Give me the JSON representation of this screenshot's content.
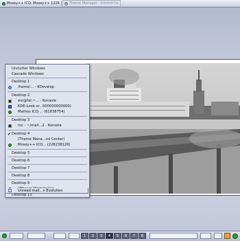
{
  "taskbar": {
    "tasks": [
      {
        "label": "Mosey++ ICQ: Mosey++ 1226",
        "active": true
      },
      {
        "label": "Theme Manager - Control Ce",
        "active": false
      }
    ]
  },
  "menu": {
    "items": [
      {
        "label": "Unclutter Windows",
        "kind": "action"
      },
      {
        "label": "Cascade Windows",
        "kind": "action"
      },
      {
        "label": "Desktop 1",
        "kind": "desktop"
      },
      {
        "label": "/home/... - KDevelop",
        "kind": "window",
        "icon": "kdevelop-icon"
      },
      {
        "label": "Desktop 2",
        "kind": "desktop"
      },
      {
        "label": "esr@fal:~... - Konsole",
        "kind": "window",
        "icon": "konsole-icon"
      },
      {
        "label": "KDE-Look.or...000000000000)",
        "kind": "window",
        "icon": "kde-icon"
      },
      {
        "label": "Mathos ICQ:... (61838754)",
        "kind": "window",
        "icon": "icq-icon"
      },
      {
        "label": "Desktop 3",
        "kind": "desktop"
      },
      {
        "label": "mc - ~/mail...2 - Konsole",
        "kind": "window",
        "icon": "konsole-icon"
      },
      {
        "label": "Desktop 4",
        "kind": "desktop",
        "checked": true
      },
      {
        "label": "(Theme Mana...rol Center)",
        "kind": "window",
        "icon": "theme-icon"
      },
      {
        "label": "Mosey++ ICQ... (226238126)",
        "kind": "window",
        "icon": "icq-icon"
      },
      {
        "label": "Desktop 5",
        "kind": "desktop"
      },
      {
        "label": "Desktop 6",
        "kind": "desktop"
      },
      {
        "label": "Desktop 7",
        "kind": "desktop"
      },
      {
        "label": "Desktop 8",
        "kind": "desktop"
      },
      {
        "label": "Desktop 9",
        "kind": "desktop"
      },
      {
        "label": "VMware Workstation",
        "kind": "window",
        "icon": "vmware-icon"
      },
      {
        "label": "Desktop 10",
        "kind": "desktop"
      },
      {
        "label": "Unread mail...n Evolution",
        "kind": "window",
        "icon": "mail-icon"
      }
    ]
  },
  "pager": {
    "desktops": [
      "1",
      "2",
      "3",
      "4",
      "5",
      "6",
      "7",
      "8"
    ],
    "active_index": 3
  },
  "colors": {
    "accent": "#2a9a2a",
    "menu_bg": "#dfe3ee",
    "panel": "#c9cfe0"
  }
}
